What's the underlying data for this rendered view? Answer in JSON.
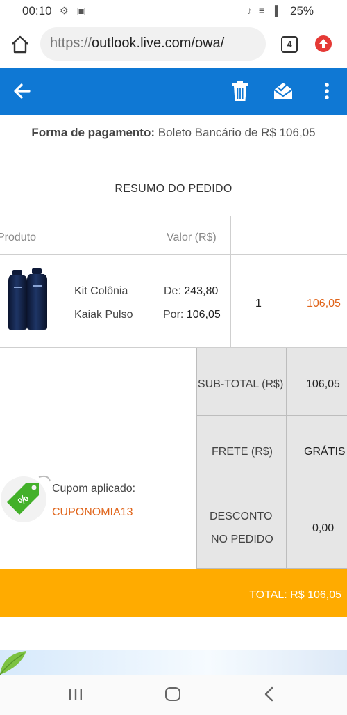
{
  "status_bar": {
    "time": "00:10",
    "battery": "25%",
    "left_icons": "⚙ ▣",
    "right_icons": "♪ ≡ ▐"
  },
  "browser": {
    "url_scheme": "https://",
    "url_rest": "outlook.live.com/owa/",
    "tab_count": "4"
  },
  "colors": {
    "toolbar": "#0f78d4",
    "accent_orange": "#e0641a",
    "total_bar": "#ffab00"
  },
  "order": {
    "payment_label": "Forma de pagamento:",
    "payment_value": "Boleto Bancário de R$ 106,05",
    "summary_title": "RESUMO DO PEDIDO",
    "headers": {
      "product": "Produto",
      "value": "Valor (R$)"
    },
    "item": {
      "name_line1": "Kit Colônia",
      "name_line2": "Kaiak Pulso",
      "price_from_label": "De:",
      "price_from": "243,80",
      "price_to_label": "Por:",
      "price_to": "106,05",
      "quantity": "1",
      "total": "106,05"
    },
    "coupon": {
      "label": "Cupom aplicado:",
      "code": "CUPONOMIA13"
    },
    "totals": {
      "subtotal_label": "SUB-TOTAL (R$)",
      "subtotal_value": "106,05",
      "shipping_label": "FRETE (R$)",
      "shipping_value": "GRÁTIS",
      "discount_label_line1": "DESCONTO",
      "discount_label_line2": "NO PEDIDO",
      "discount_value": "0,00",
      "total_text": "TOTAL: R$ 106,05"
    }
  }
}
